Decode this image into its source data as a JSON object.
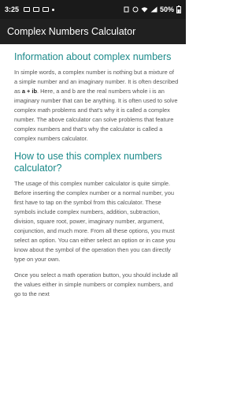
{
  "status_bar": {
    "time": "3:25",
    "battery": "50%"
  },
  "app_bar": {
    "title": "Complex Numbers Calculator"
  },
  "sections": [
    {
      "heading": "Information about complex numbers",
      "paragraphs": [
        {
          "before": "In simple words, a complex number is nothing but a mixture of a simple number and an imaginary number. It is often described as ",
          "bold": "a + ib",
          "after": ". Here, a and b are the real numbers whole i is an imaginary number that can be anything. It is often used to solve complex math problems and that's why it is called a complex number. The above calculator can solve problems that feature complex numbers and that's why the calculator is called a complex numbers calculator."
        }
      ]
    },
    {
      "heading": "How to use this complex numbers calculator?",
      "paragraphs": [
        "The usage of this complex number calculator is quite simple. Before inserting the complex number or a normal number, you first have to tap on the symbol from this calculator. These symbols include complex numbers, addition, subtraction, division, square root, power, imaginary number, argument, conjunction, and much more. From all these options, you must select an option. You can either select an option or in case you know about the symbol of the operation then you can directly type on your own.",
        "Once you select a math operation button, you should include all the values either in simple numbers or complex numbers, and go to the next"
      ]
    }
  ]
}
